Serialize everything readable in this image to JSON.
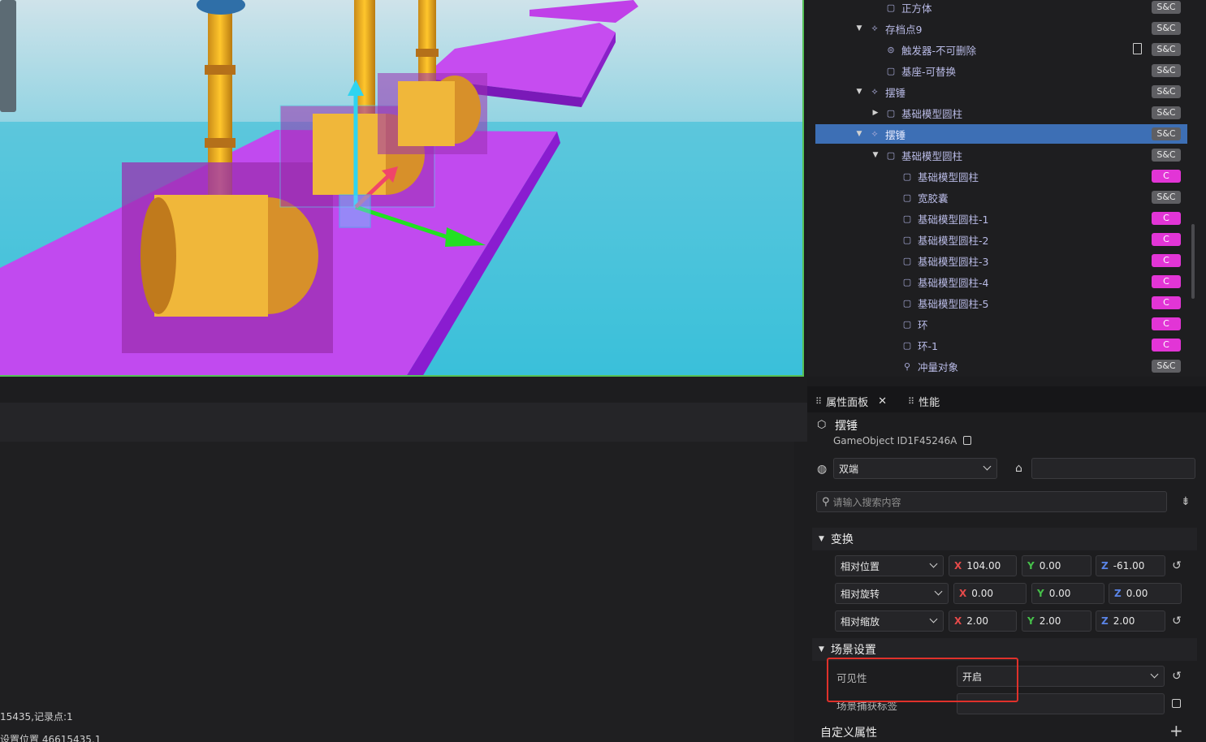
{
  "hierarchy": {
    "rows": [
      {
        "label": "正方体",
        "badge": "S&C",
        "badge_type": "sc",
        "depth": 2,
        "arrow": "",
        "icon": "cube-icon"
      },
      {
        "label": "存档点9",
        "badge": "S&C",
        "badge_type": "sc",
        "depth": 1,
        "arrow": "down",
        "icon": "prefab-icon"
      },
      {
        "label": "触发器-不可删除",
        "badge": "S&C",
        "badge_type": "sc",
        "depth": 2,
        "arrow": "",
        "icon": "trigger-icon",
        "doc": true
      },
      {
        "label": "基座-可替换",
        "badge": "S&C",
        "badge_type": "sc",
        "depth": 2,
        "arrow": "",
        "icon": "cube-icon"
      },
      {
        "label": "摆锤",
        "badge": "S&C",
        "badge_type": "sc",
        "depth": 1,
        "arrow": "down",
        "icon": "prefab-icon"
      },
      {
        "label": "基础模型圆柱",
        "badge": "S&C",
        "badge_type": "sc",
        "depth": 2,
        "arrow": "right",
        "icon": "cube-icon"
      },
      {
        "label": "摆锤",
        "badge": "S&C",
        "badge_type": "sc",
        "depth": 1,
        "arrow": "down",
        "icon": "prefab-icon",
        "selected": true
      },
      {
        "label": "基础模型圆柱",
        "badge": "S&C",
        "badge_type": "sc",
        "depth": 2,
        "arrow": "down",
        "icon": "cube-icon"
      },
      {
        "label": "基础模型圆柱",
        "badge": "C",
        "badge_type": "c",
        "depth": 3,
        "arrow": "",
        "icon": "cube-icon"
      },
      {
        "label": "宽胶囊",
        "badge": "S&C",
        "badge_type": "sc",
        "depth": 3,
        "arrow": "",
        "icon": "cube-icon"
      },
      {
        "label": "基础模型圆柱-1",
        "badge": "C",
        "badge_type": "c",
        "depth": 3,
        "arrow": "",
        "icon": "cube-icon"
      },
      {
        "label": "基础模型圆柱-2",
        "badge": "C",
        "badge_type": "c",
        "depth": 3,
        "arrow": "",
        "icon": "cube-icon"
      },
      {
        "label": "基础模型圆柱-3",
        "badge": "C",
        "badge_type": "c",
        "depth": 3,
        "arrow": "",
        "icon": "cube-icon"
      },
      {
        "label": "基础模型圆柱-4",
        "badge": "C",
        "badge_type": "c",
        "depth": 3,
        "arrow": "",
        "icon": "cube-icon"
      },
      {
        "label": "基础模型圆柱-5",
        "badge": "C",
        "badge_type": "c",
        "depth": 3,
        "arrow": "",
        "icon": "cube-icon"
      },
      {
        "label": "环",
        "badge": "C",
        "badge_type": "c",
        "depth": 3,
        "arrow": "",
        "icon": "cube-icon"
      },
      {
        "label": "环-1",
        "badge": "C",
        "badge_type": "c",
        "depth": 3,
        "arrow": "",
        "icon": "cube-icon"
      },
      {
        "label": "冲量对象",
        "badge": "S&C",
        "badge_type": "sc",
        "depth": 3,
        "arrow": "",
        "icon": "impulse-icon"
      }
    ]
  },
  "props": {
    "tabs": [
      "属性面板",
      "性能"
    ],
    "object_name": "摆锤",
    "object_id": "GameObject ID1F45246A",
    "net_mode": "双端",
    "tag_value": "",
    "search_placeholder": "请输入搜索内容",
    "transform": {
      "title": "变换",
      "position": {
        "label": "相对位置",
        "x": "104.00",
        "y": "0.00",
        "z": "-61.00"
      },
      "rotation": {
        "label": "相对旋转",
        "x": "0.00",
        "y": "0.00",
        "z": "0.00"
      },
      "scale": {
        "label": "相对缩放",
        "x": "2.00",
        "y": "2.00",
        "z": "2.00"
      }
    },
    "scene": {
      "title": "场景设置",
      "visibility_label": "可见性",
      "visibility_value": "开启",
      "capture_label": "场景捕获标签",
      "capture_value": ""
    },
    "custom_title": "自定义属性"
  },
  "axes": {
    "x": "X",
    "y": "Y",
    "z": "Z"
  },
  "log": {
    "line1": "15435,记录点:1",
    "line2": "设置位置 46615435,1"
  },
  "colors": {
    "selection": "#3d6fb5",
    "badge_sc": "#5f5f63",
    "badge_c": "#e235d6",
    "viewport_border": "#55c157",
    "highlight_box": "#e0312b"
  }
}
